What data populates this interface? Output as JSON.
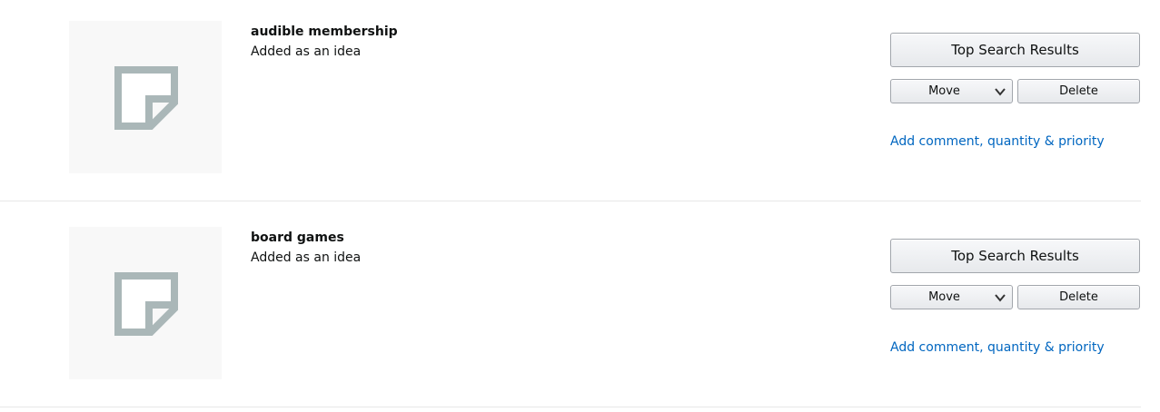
{
  "list_items": [
    {
      "title": "audible membership",
      "subtitle": "Added as an idea",
      "top_search_label": "Top Search Results",
      "move_label": "Move",
      "delete_label": "Delete",
      "comment_link": "Add comment, quantity & priority",
      "thumbnail_icon": "idea-note-icon"
    },
    {
      "title": "board games",
      "subtitle": "Added as an idea",
      "top_search_label": "Top Search Results",
      "move_label": "Move",
      "delete_label": "Delete",
      "comment_link": "Add comment, quantity & priority",
      "thumbnail_icon": "idea-note-icon"
    }
  ],
  "colors": {
    "link": "#0066c0",
    "icon": "#aab7b8",
    "thumbnail_bg": "#f8f8f8",
    "divider": "#e7e7e7"
  }
}
